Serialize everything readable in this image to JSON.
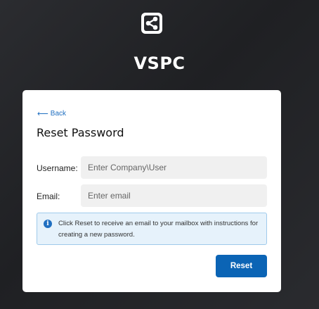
{
  "app": {
    "title": "VSPC",
    "logo_icon": "share-nodes-icon"
  },
  "form": {
    "back_label": "Back",
    "back_icon": "arrow-left-icon",
    "heading": "Reset Password",
    "username": {
      "label": "Username:",
      "value": "",
      "placeholder": "Enter Company\\User"
    },
    "email": {
      "label": "Email:",
      "value": "",
      "placeholder": "Enter email"
    },
    "info": {
      "icon": "info-icon",
      "text": "Click Reset to receive an email to your mailbox with instructions for creating a new password."
    },
    "reset_label": "Reset"
  },
  "colors": {
    "accent": "#0b64b5",
    "link": "#1f6fc1",
    "info_bg": "#e6f2fb",
    "info_border": "#9fcaeb",
    "background": "#24252a"
  }
}
